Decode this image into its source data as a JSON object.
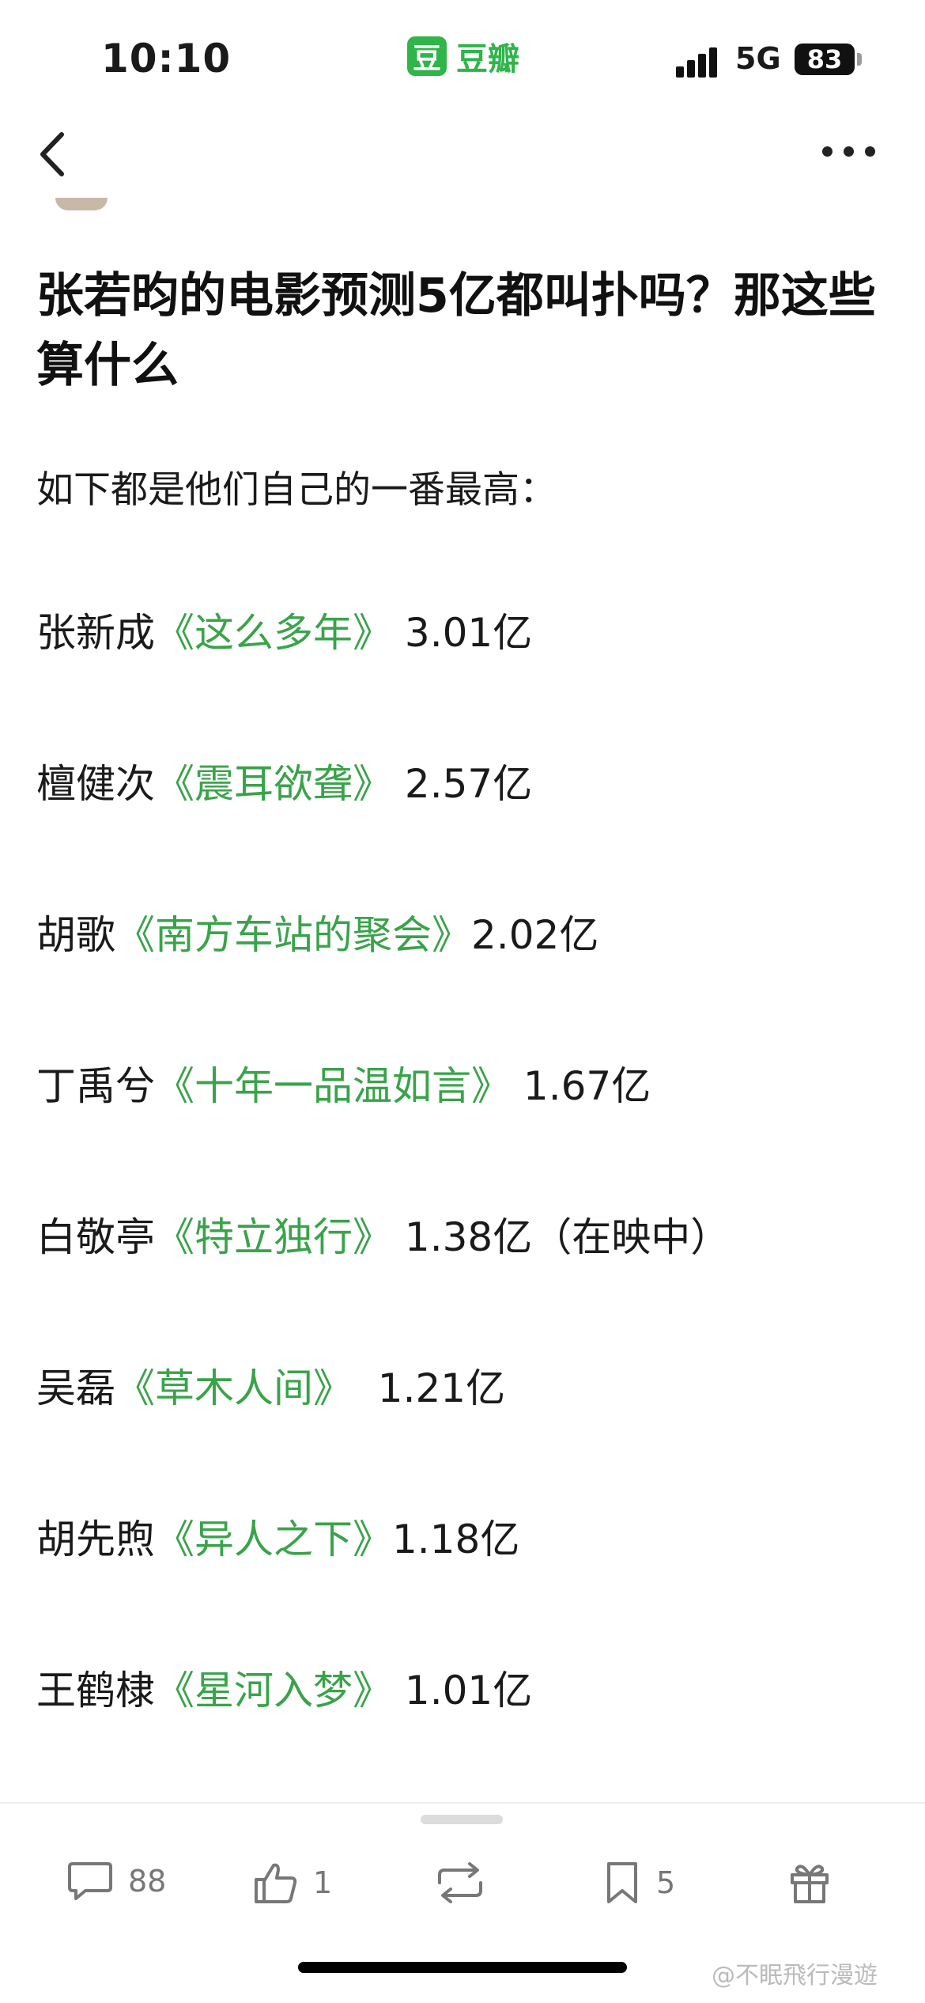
{
  "status_bar": {
    "time": "10:10",
    "app_icon_glyph": "豆",
    "app_name": "豆瓣",
    "network": "5G",
    "battery": "83"
  },
  "post": {
    "title": "张若昀的电影预测5亿都叫扑吗？那这些算什么",
    "intro": "如下都是他们自己的一番最高：",
    "items": [
      {
        "name": "张新成",
        "movie": "《这么多年》",
        "box": " 3.01亿"
      },
      {
        "name": "檀健次",
        "movie": "《震耳欲聋》",
        "box": " 2.57亿"
      },
      {
        "name": "胡歌",
        "movie": "《南方车站的聚会》",
        "box": "2.02亿"
      },
      {
        "name": "丁禹兮",
        "movie": "《十年一品温如言》",
        "box": " 1.67亿"
      },
      {
        "name": "白敬亭",
        "movie": "《特立独行》",
        "box": " 1.38亿（在映中）"
      },
      {
        "name": "吴磊",
        "movie": "《草木人间》",
        "box": "  1.21亿"
      },
      {
        "name": "胡先煦",
        "movie": "《异人之下》",
        "box": "1.18亿"
      },
      {
        "name": "王鹤棣",
        "movie": "《星河入梦》",
        "box": " 1.01亿"
      }
    ]
  },
  "toolbar": {
    "comments_count": "88",
    "likes_count": "1",
    "collect_count": "5"
  },
  "icons": {
    "back": "chevron-left-icon",
    "more": "more-dots-icon",
    "comment": "comment-bubble-icon",
    "like": "thumbs-up-icon",
    "repost": "repost-icon",
    "collect": "bookmark-icon",
    "gift": "gift-icon"
  },
  "watermark": "@不眠飛行漫遊",
  "colors": {
    "accent_green": "#2fb54a",
    "movie_title_green": "#3aa34a"
  }
}
